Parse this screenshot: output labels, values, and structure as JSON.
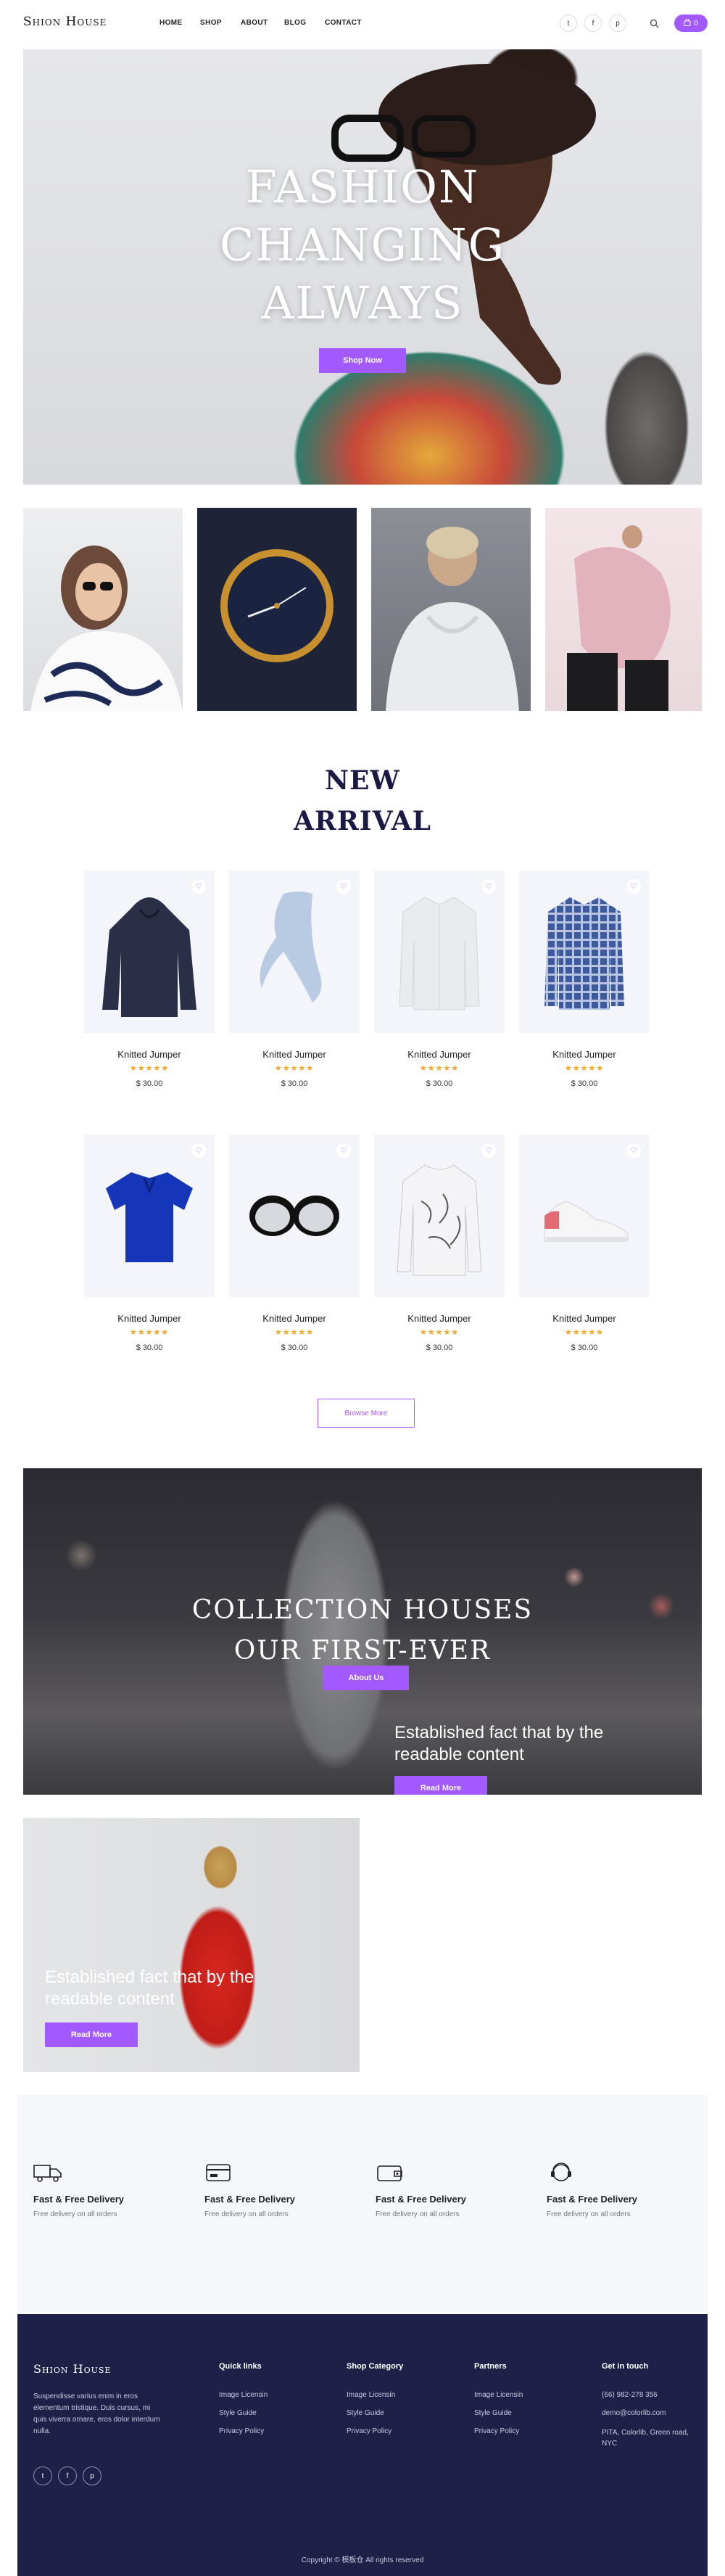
{
  "header": {
    "logo": "Shion House",
    "nav": [
      "HOME",
      "SHOP",
      "ABOUT",
      "BLOG",
      "CONTACT"
    ],
    "social_icons": [
      "twitter-icon",
      "facebook-icon",
      "pinterest-icon"
    ],
    "cart_count": "0"
  },
  "hero": {
    "title_lines": [
      "FASHION",
      "CHANGING",
      "ALWAYS"
    ],
    "button": "Shop Now"
  },
  "new_arrival": {
    "title_lines": [
      "NEW",
      "ARRIVAL"
    ],
    "products": [
      {
        "name": "Knitted Jumper",
        "price": "$ 30.00",
        "stars": "★★★★★",
        "icon": "hoodie-icon"
      },
      {
        "name": "Knitted Jumper",
        "price": "$ 30.00",
        "stars": "★★★★★",
        "icon": "scarf-icon"
      },
      {
        "name": "Knitted Jumper",
        "price": "$ 30.00",
        "stars": "★★★★★",
        "icon": "white-shirt-icon"
      },
      {
        "name": "Knitted Jumper",
        "price": "$ 30.00",
        "stars": "★★★★★",
        "icon": "plaid-shirt-icon"
      },
      {
        "name": "Knitted Jumper",
        "price": "$ 30.00",
        "stars": "★★★★★",
        "icon": "polo-shirt-icon"
      },
      {
        "name": "Knitted Jumper",
        "price": "$ 30.00",
        "stars": "★★★★★",
        "icon": "sunglasses-icon"
      },
      {
        "name": "Knitted Jumper",
        "price": "$ 30.00",
        "stars": "★★★★★",
        "icon": "printed-sweater-icon"
      },
      {
        "name": "Knitted Jumper",
        "price": "$ 30.00",
        "stars": "★★★★★",
        "icon": "sneaker-icon"
      }
    ],
    "browse_more": "Browse More"
  },
  "collection": {
    "title_lines": [
      "COLLECTION HOUSES",
      "OUR FIRST-EVER"
    ],
    "about_button": "About Us",
    "text": "Established fact that by the readable content",
    "read_more": "Read More"
  },
  "promo": {
    "text": "Established fact that by the readable content",
    "read_more": "Read More"
  },
  "features": [
    {
      "icon": "truck-icon",
      "title": "Fast & Free Delivery",
      "desc": "Free delivery on all orders"
    },
    {
      "icon": "credit-card-icon",
      "title": "Fast & Free Delivery",
      "desc": "Free delivery on all orders"
    },
    {
      "icon": "wallet-icon",
      "title": "Fast & Free Delivery",
      "desc": "Free delivery on all orders"
    },
    {
      "icon": "support-icon",
      "title": "Fast & Free Delivery",
      "desc": "Free delivery on all orders"
    }
  ],
  "footer": {
    "logo": "Shion House",
    "about": "Suspendisse varius enim in eros elementum tristique. Duis cursus, mi quis viverra ornare, eros dolor interdum nulla.",
    "columns": [
      {
        "title": "Quick links",
        "links": [
          "Image Licensin",
          "Style Guide",
          "Privacy Policy"
        ]
      },
      {
        "title": "Shop Category",
        "links": [
          "Image Licensin",
          "Style Guide",
          "Privacy Policy"
        ]
      },
      {
        "title": "Partners",
        "links": [
          "Image Licensin",
          "Style Guide",
          "Privacy Policy"
        ]
      },
      {
        "title": "Get in touch",
        "links": [
          "(66) 982-278 356",
          "demo@colorlib.com",
          "PITA, Colorlib, Green road, NYC"
        ]
      }
    ],
    "social_icons": [
      "twitter-icon",
      "facebook-icon",
      "pinterest-icon"
    ],
    "copyright": "Copyright © 模板仓 All rights reserved"
  },
  "colors": {
    "accent": "#a259ff",
    "footer_bg": "#1e2147",
    "title": "#1b1a44",
    "star": "#f5a623"
  }
}
